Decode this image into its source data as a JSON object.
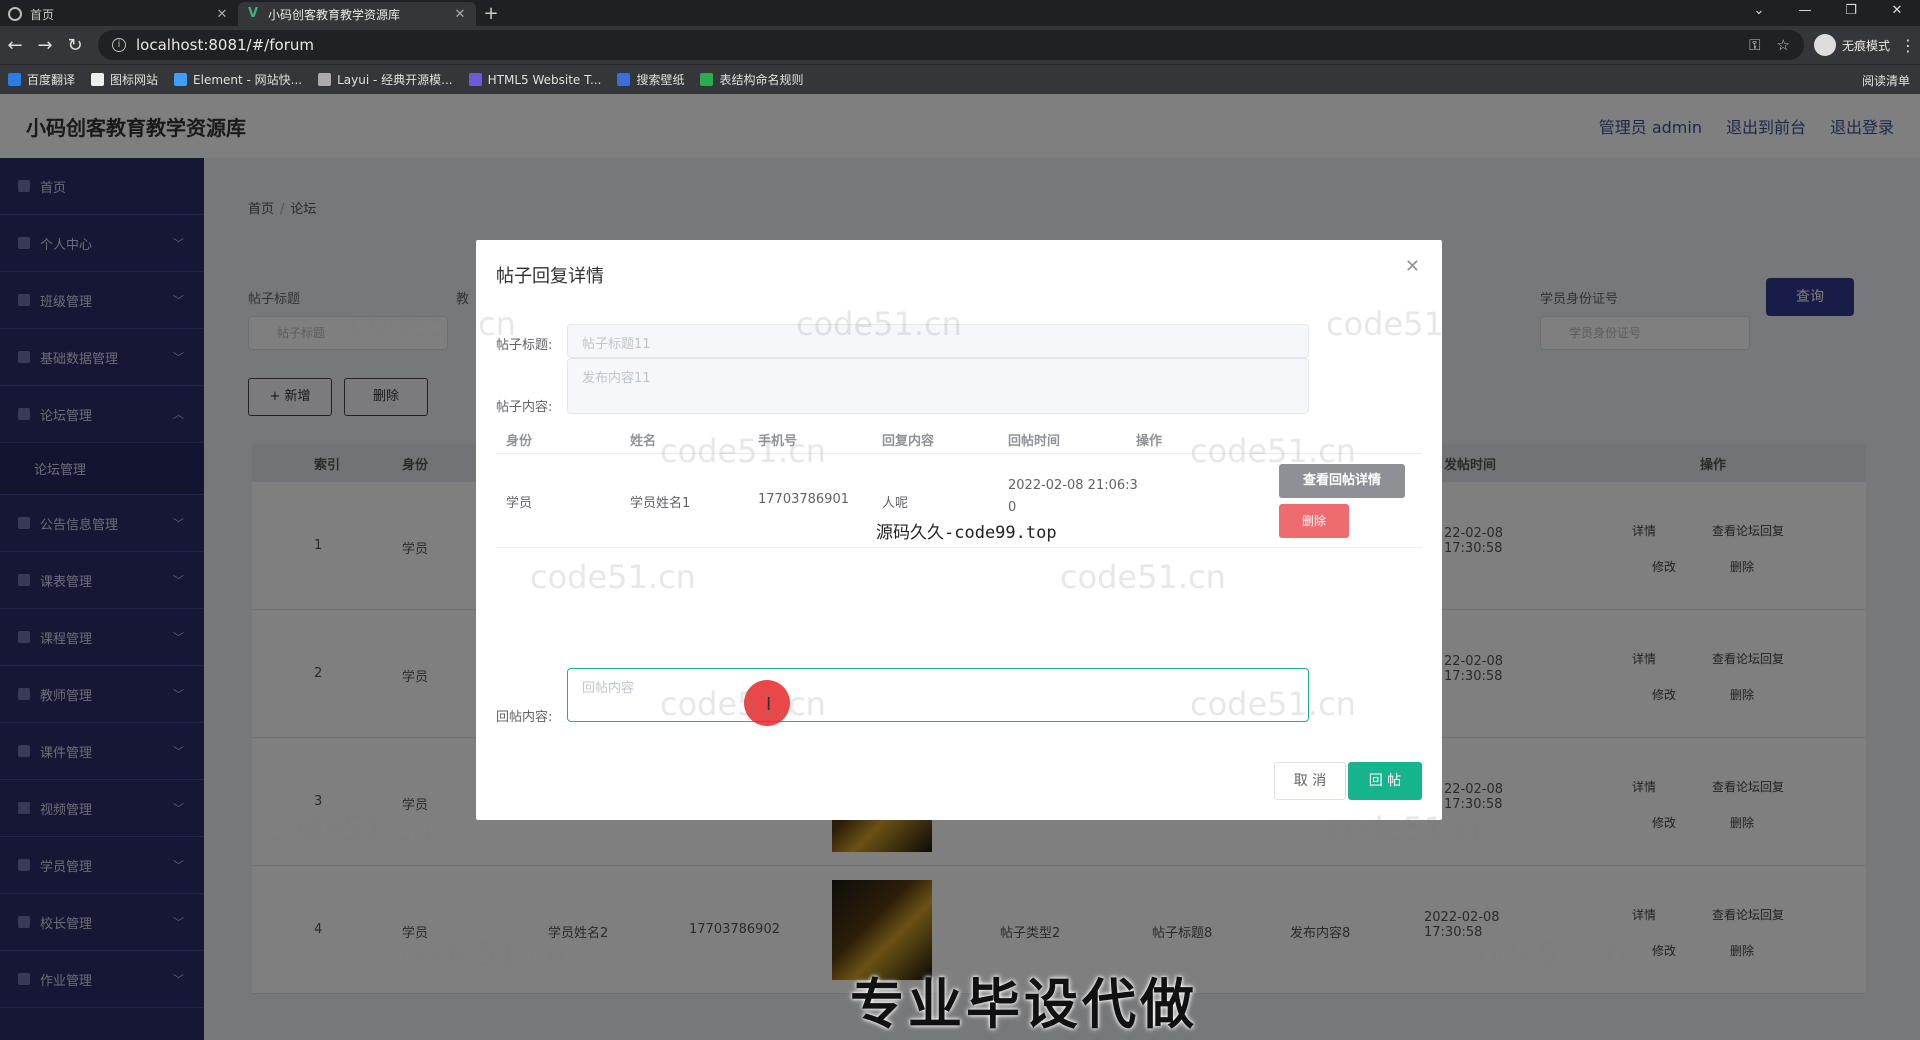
{
  "browser": {
    "tabs": [
      {
        "title": "首页",
        "active": false
      },
      {
        "title": "小码创客教育教学资源库",
        "active": true
      }
    ],
    "url": "localhost:8081/#/forum",
    "incognito_label": "无痕模式",
    "bookmarks": [
      "百度翻译",
      "图标网站",
      "Element - 网站快...",
      "Layui - 经典开源模...",
      "HTML5 Website T...",
      "搜索壁纸",
      "表结构命名规则"
    ],
    "reading_list": "阅读清单"
  },
  "header": {
    "title": "小码创客教育教学资源库",
    "links": [
      "管理员 admin",
      "退出到前台",
      "退出登录"
    ]
  },
  "sidebar": {
    "items": [
      {
        "label": "首页"
      },
      {
        "label": "个人中心"
      },
      {
        "label": "班级管理"
      },
      {
        "label": "基础数据管理"
      },
      {
        "label": "论坛管理"
      },
      {
        "label": "论坛管理",
        "sub": true
      },
      {
        "label": "公告信息管理"
      },
      {
        "label": "课表管理"
      },
      {
        "label": "课程管理"
      },
      {
        "label": "教师管理"
      },
      {
        "label": "课件管理"
      },
      {
        "label": "视频管理"
      },
      {
        "label": "学员管理"
      },
      {
        "label": "校长管理"
      },
      {
        "label": "作业管理"
      }
    ]
  },
  "page": {
    "breadcrumb": [
      "首页",
      "论坛"
    ],
    "filters": {
      "title_label": "帖子标题",
      "title_placeholder": "帖子标题",
      "teacher_label": "教",
      "id_label": "学员身份证号",
      "id_placeholder": "学员身份证号",
      "query": "查询"
    },
    "buttons": {
      "add": "+ 新增",
      "delete": "删除"
    },
    "table": {
      "headers": [
        "索引",
        "身份",
        "发帖时间",
        "操作"
      ],
      "rows": [
        {
          "index": "1",
          "role": "学员",
          "name": "",
          "phone": "",
          "type": "",
          "title": "",
          "content": "",
          "time": "22-02-08 17:30:58"
        },
        {
          "index": "2",
          "role": "学员",
          "name": "",
          "phone": "",
          "type": "",
          "title": "",
          "content": "",
          "time": "22-02-08 17:30:58"
        },
        {
          "index": "3",
          "role": "学员",
          "name": "",
          "phone": "",
          "type": "",
          "title": "",
          "content": "",
          "time": "22-02-08 17:30:58"
        },
        {
          "index": "4",
          "role": "学员",
          "name": "学员姓名2",
          "phone": "17703786902",
          "type": "帖子类型2",
          "title": "帖子标题8",
          "content": "发布内容8",
          "time": "2022-02-08 17:30:58"
        }
      ],
      "actions": [
        "详情",
        "查看论坛回复",
        "修改",
        "删除"
      ]
    }
  },
  "dialog": {
    "title": "帖子回复详情",
    "post_title_label": "帖子标题:",
    "post_title_value": "帖子标题11",
    "post_content_label": "帖子内容:",
    "post_content_value": "发布内容11",
    "table": {
      "headers": [
        "身份",
        "姓名",
        "手机号",
        "回复内容",
        "回帖时间",
        "操作"
      ],
      "rows": [
        {
          "role": "学员",
          "name": "学员姓名1",
          "phone": "17703786901",
          "content": "人呢",
          "time_line1": "2022-02-08 21:06:3",
          "time_line2": "0"
        }
      ],
      "view_btn": "查看回帖详情",
      "delete_btn": "删除"
    },
    "reply_label": "回帖内容:",
    "reply_placeholder": "回帖内容",
    "cancel": "取 消",
    "submit": "回 帖"
  },
  "overlays": {
    "watermark_text": "code51.cn",
    "site_mark": "源码久久-code99.top",
    "banner": "专业毕设代做"
  },
  "colors": {
    "sidebar_bg": "#2d2f6b",
    "primary": "#33398f",
    "reply_green": "#16b48d",
    "danger": "#ee6b6f"
  }
}
